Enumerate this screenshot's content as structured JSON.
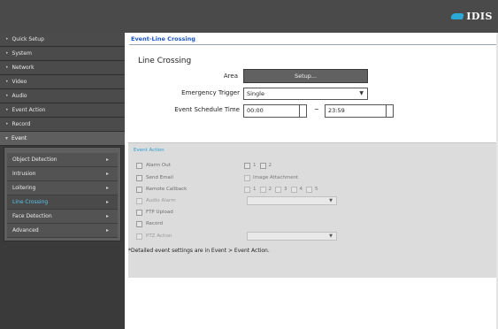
{
  "brand": {
    "logo_text": "IDIS",
    "accent": "#2aa9d6"
  },
  "sidebar": {
    "items": [
      {
        "label": "Quick Setup"
      },
      {
        "label": "System"
      },
      {
        "label": "Network"
      },
      {
        "label": "Video"
      },
      {
        "label": "Audio"
      },
      {
        "label": "Event Action"
      },
      {
        "label": "Record"
      },
      {
        "label": "Event"
      }
    ],
    "sub_items": [
      {
        "label": "Object Detection"
      },
      {
        "label": "Intrusion"
      },
      {
        "label": "Loitering"
      },
      {
        "label": "Line Crossing"
      },
      {
        "label": "Face Detection"
      },
      {
        "label": "Advanced"
      }
    ]
  },
  "main": {
    "page_title": "Event-Line Crossing",
    "section_title": "Line Crossing",
    "area_label": "Area",
    "setup_button": "Setup...",
    "trigger_label": "Emergency Trigger",
    "trigger_value": "Single",
    "schedule_label": "Event Schedule Time",
    "time_start": "00:00",
    "time_dash": "~",
    "time_end": "23:59"
  },
  "event_action": {
    "title": "Event Action",
    "rows": [
      {
        "label": "Alarm Out"
      },
      {
        "label": "Send Email"
      },
      {
        "label": "Remote Callback"
      },
      {
        "label": "Audio Alarm"
      },
      {
        "label": "FTP Upload"
      },
      {
        "label": "Record"
      },
      {
        "label": "PTZ Action"
      }
    ],
    "alarm_out_options": [
      "1",
      "2"
    ],
    "image_attachment": "Image Attachment",
    "callback_options": [
      "1",
      "2",
      "3",
      "4",
      "5"
    ]
  },
  "footnote": "*Detailed event settings are in Event > Event Action."
}
